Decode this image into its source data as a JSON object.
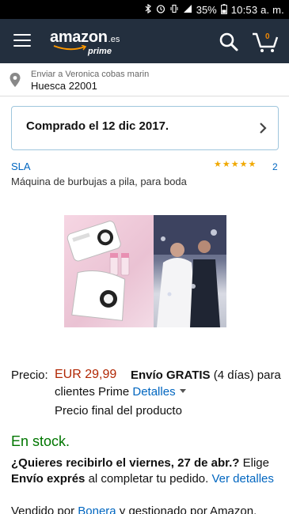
{
  "status_bar": {
    "battery": "35%",
    "time": "10:53 a. m."
  },
  "header": {
    "logo_word": "amazon",
    "logo_tld": ".es",
    "logo_prime": "prime",
    "cart_count": "0"
  },
  "delivery": {
    "line1": "Enviar a Veronica cobas marin",
    "line2": "Huesca 22001"
  },
  "order": {
    "purchased_text": "Comprado el 12 dic 2017."
  },
  "product": {
    "brand": "SLA",
    "rating_count": "2",
    "stars": 5,
    "title": "Máquina de burbujas a pila, para boda"
  },
  "price": {
    "label": "Precio:",
    "value": "EUR 29,99",
    "shipping_bold": "Envío GRATIS",
    "shipping_days": "(4 días) para",
    "shipping_line2": "clientes Prime",
    "details_link": "Detalles",
    "final_price": "Precio final del producto"
  },
  "stock": {
    "status": "En stock.",
    "question_bold": "¿Quieres recibirlo el viernes, 27 de abr.?",
    "elige": "Elige",
    "express_bold": "Envío exprés",
    "complete": "al completar tu pedido.",
    "ver_detalles": "Ver detalles",
    "sold_by_prefix": "Vendido por",
    "seller": "Bonera",
    "sold_by_suffix": "y gestionado por Amazon."
  },
  "colors": {
    "header_bg": "#232f3e",
    "link": "#0066c0",
    "price": "#b12704",
    "stock": "#007600",
    "star": "#f0a800"
  }
}
